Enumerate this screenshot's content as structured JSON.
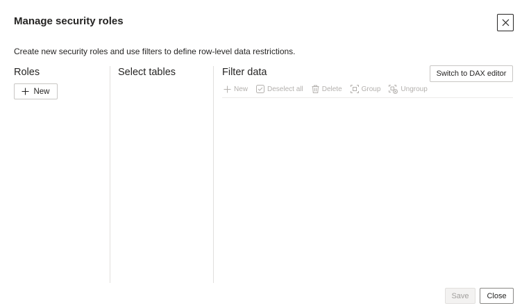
{
  "dialog": {
    "title": "Manage security roles",
    "description": "Create new security roles and use filters to define row-level data restrictions."
  },
  "roles": {
    "heading": "Roles",
    "new_button_label": "New"
  },
  "tables": {
    "heading": "Select tables"
  },
  "filter": {
    "heading": "Filter data",
    "switch_button_label": "Switch to DAX editor",
    "toolbar": {
      "new_label": "New",
      "deselect_label": "Deselect all",
      "delete_label": "Delete",
      "group_label": "Group",
      "ungroup_label": "Ungroup"
    }
  },
  "footer": {
    "save_label": "Save",
    "close_label": "Close"
  },
  "icons": {
    "close": "close-icon",
    "add": "plus-icon",
    "deselect": "checkbox-icon",
    "delete": "trash-icon",
    "group": "group-icon",
    "ungroup": "ungroup-icon"
  },
  "colors": {
    "text": "#252423",
    "disabled_text": "#b3b0ad",
    "divider": "#e1dfdd"
  }
}
